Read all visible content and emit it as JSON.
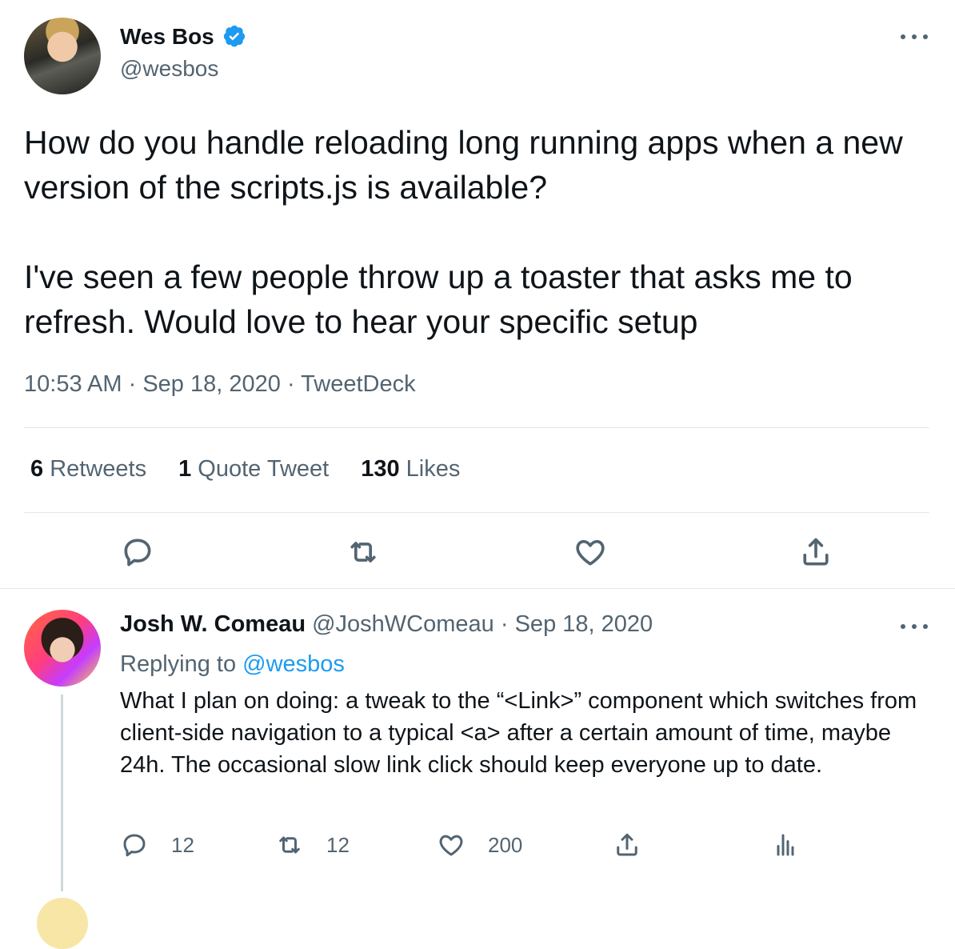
{
  "tweet": {
    "author_name": "Wes Bos",
    "author_handle": "@wesbos",
    "paragraphs": [
      "How do you handle reloading long running apps when a new version of the scripts.js is available?",
      "I've seen a few people throw up a toaster that asks me to refresh. Would love to hear your specific setup"
    ],
    "time": "10:53 AM",
    "date": "Sep 18, 2020",
    "source": "TweetDeck",
    "sep": "·",
    "stats": {
      "retweets_count": "6",
      "retweets_label": "Retweets",
      "quotes_count": "1",
      "quotes_label": "Quote Tweet",
      "likes_count": "130",
      "likes_label": "Likes"
    }
  },
  "reply": {
    "author_name": "Josh W. Comeau",
    "author_handle": "@JoshWComeau",
    "sep": "·",
    "date": "Sep 18, 2020",
    "replying_prefix": "Replying to",
    "replying_handle": "@wesbos",
    "text": "What I plan on doing: a tweak to the “<Link>” component which switches from client-side navigation to a typical <a> after a certain amount of time, maybe 24h. The occasional slow link click should keep everyone up to date.",
    "reply_count": "12",
    "retweet_count": "12",
    "like_count": "200"
  },
  "colors": {
    "accent": "#1d9bf0",
    "muted": "#536471",
    "text": "#0f1419",
    "divider": "#e1e8ed"
  },
  "icons": [
    "verified-badge-icon",
    "more-icon",
    "reply-icon",
    "retweet-icon",
    "like-icon",
    "share-icon",
    "analytics-icon"
  ]
}
